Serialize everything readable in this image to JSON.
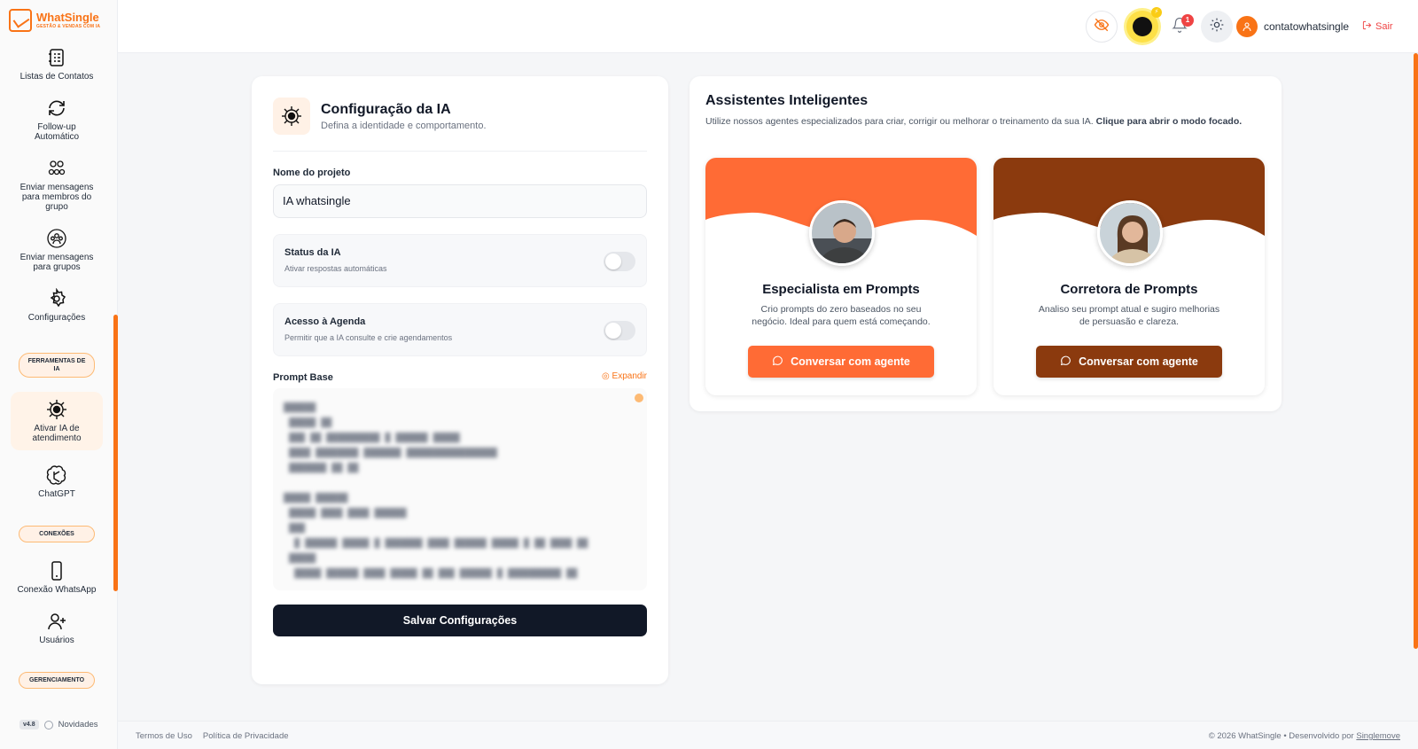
{
  "brand": {
    "name": "WhatSingle",
    "tagline": "GESTÃO & VENDAS COM IA"
  },
  "sidebar": {
    "items": [
      {
        "label": "Listas de Contatos",
        "icon": "contacts-book-icon"
      },
      {
        "label": "Follow-up Automático",
        "icon": "refresh-icon"
      },
      {
        "label": "Enviar mensagens para membros do grupo",
        "icon": "group-members-icon"
      },
      {
        "label": "Enviar mensagens para grupos",
        "icon": "group-circle-icon"
      },
      {
        "label": "Configurações",
        "icon": "gear-icon"
      }
    ],
    "section_tools": "FERRAMENTAS DE IA",
    "tools": [
      {
        "label": "Ativar IA de atendimento",
        "icon": "ai-chip-icon",
        "active": true
      },
      {
        "label": "ChatGPT",
        "icon": "openai-icon"
      }
    ],
    "section_connections": "CONEXÕES",
    "connections": [
      {
        "label": "Conexão WhatsApp",
        "icon": "phone-icon"
      },
      {
        "label": "Usuários",
        "icon": "user-plus-icon"
      }
    ],
    "section_management": "GERENCIAMENTO",
    "version": "v4.8",
    "news": "Novidades"
  },
  "topbar": {
    "brain_badge": "⚡",
    "bell_badge": "1",
    "username": "contatowhatsingle",
    "logout": "Sair",
    "accent": "#f97316"
  },
  "config": {
    "title": "Configuração da IA",
    "subtitle": "Defina a identidade e comportamento.",
    "project_label": "Nome do projeto",
    "project_value": "IA whatsingle",
    "status_title": "Status da IA",
    "status_desc": "Ativar respostas automáticas",
    "status_on": false,
    "agenda_title": "Acesso à Agenda",
    "agenda_desc": "Permitir que a IA consulte e crie agendamentos",
    "agenda_on": false,
    "prompt_label": "Prompt Base",
    "expand": "Expandir",
    "save": "Salvar Configurações"
  },
  "assistants": {
    "title": "Assistentes Inteligentes",
    "desc": "Utilize nossos agentes especializados para criar, corrigir ou melhorar o treinamento da sua IA.",
    "desc_bold": "Clique para abrir o modo focado.",
    "agents": [
      {
        "name": "Especialista em Prompts",
        "desc": "Crio prompts do zero baseados no seu negócio. Ideal para quem está começando.",
        "button": "Conversar com agente",
        "color": "#ff6b35"
      },
      {
        "name": "Corretora de Prompts",
        "desc": "Analiso seu prompt atual e sugiro melhorias de persuasão e clareza.",
        "button": "Conversar com agente",
        "color": "#8b3a0e"
      }
    ]
  },
  "footer": {
    "terms": "Termos de Uso",
    "privacy": "Política de Privacidade",
    "copyright": "© 2026 WhatSingle • Desenvolvido por",
    "dev": "Singlemove"
  }
}
